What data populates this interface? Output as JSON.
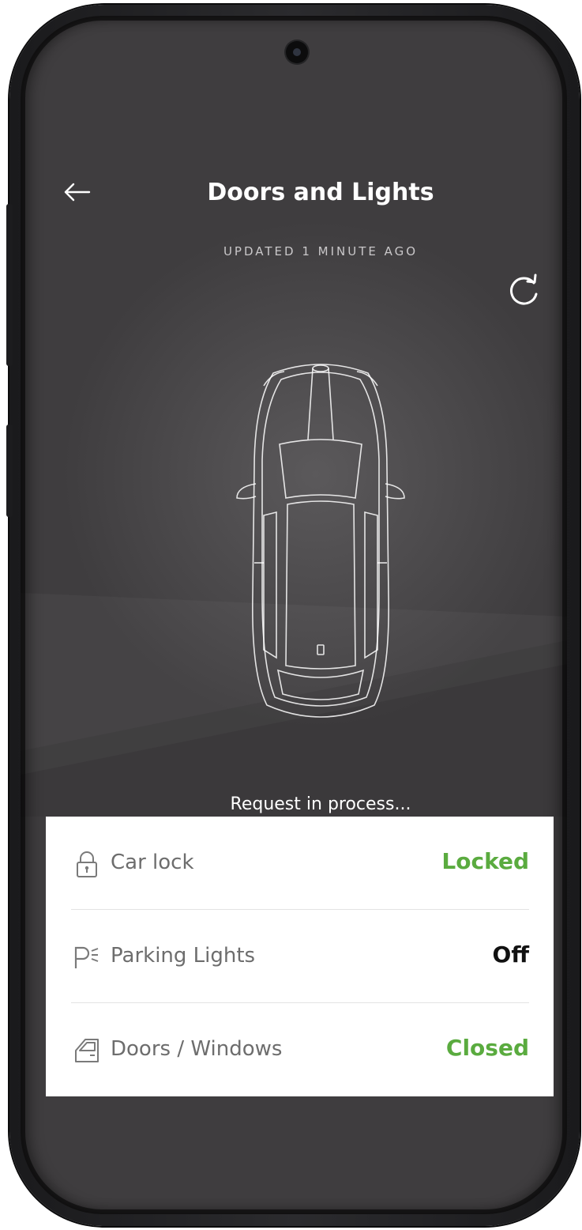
{
  "header": {
    "title": "Doors and Lights",
    "back_icon": "arrow-left-icon",
    "updated_text": "UPDATED 1 MINUTE AGO",
    "refresh_icon": "refresh-icon"
  },
  "status": {
    "message": "Request in process..."
  },
  "items": [
    {
      "label": "Car lock",
      "value": "Locked",
      "icon": "lock-icon",
      "value_color": "#5aab3f"
    },
    {
      "label": "Parking Lights",
      "value": "Off",
      "icon": "parking-lights-icon",
      "value_color": "#111111"
    },
    {
      "label": "Doors / Windows",
      "value": "Closed",
      "icon": "car-door-icon",
      "value_color": "#5aab3f"
    }
  ],
  "colors": {
    "background": "#4a484a",
    "panel": "#ffffff",
    "status_green": "#5aab3f"
  }
}
